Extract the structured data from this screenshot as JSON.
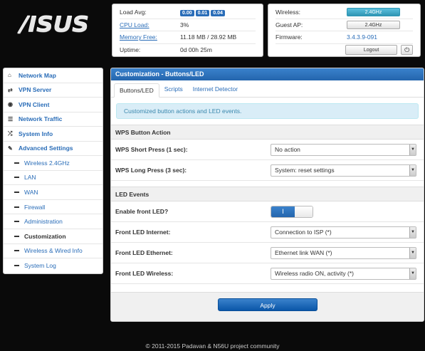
{
  "logo": {
    "text": "/ISUS"
  },
  "status_left": [
    {
      "label": "Load Avg:",
      "label_link": false,
      "badges": [
        "0.00",
        "0.01",
        "0.04"
      ]
    },
    {
      "label": "CPU Load:",
      "label_link": true,
      "value": "3%"
    },
    {
      "label": "Memory Free:",
      "label_link": true,
      "value": "11.18 MB / 28.92 MB"
    },
    {
      "label": "Uptime:",
      "label_link": false,
      "value": "0d 00h 25m"
    }
  ],
  "status_right": {
    "wireless": {
      "label": "Wireless:",
      "button": "2.4GHz"
    },
    "guest_ap": {
      "label": "Guest AP:",
      "button": "2.4GHz"
    },
    "firmware": {
      "label": "Firmware:",
      "value": "3.4.3.9-091"
    },
    "logout": "Logout",
    "power_icon": "power-icon"
  },
  "sidebar": {
    "items": [
      {
        "label": "Network Map",
        "icon": "home-icon"
      },
      {
        "label": "VPN Server",
        "icon": "swap-icon"
      },
      {
        "label": "VPN Client",
        "icon": "globe-icon"
      },
      {
        "label": "Network Traffic",
        "icon": "list-icon"
      },
      {
        "label": "System Info",
        "icon": "shuffle-icon"
      },
      {
        "label": "Advanced Settings",
        "icon": "wrench-icon"
      }
    ],
    "subitems": [
      {
        "label": "Wireless 2.4GHz"
      },
      {
        "label": "LAN"
      },
      {
        "label": "WAN"
      },
      {
        "label": "Firewall"
      },
      {
        "label": "Administration"
      },
      {
        "label": "Customization"
      },
      {
        "label": "Wireless & Wired Info"
      },
      {
        "label": "System Log"
      }
    ]
  },
  "main": {
    "header": "Customization - Buttons/LED",
    "tabs": [
      "Buttons/LED",
      "Scripts",
      "Internet Detector"
    ],
    "info": "Customized button actions and LED events.",
    "section_wps": "WPS Button Action",
    "wps_short": {
      "label": "WPS Short Press (1 sec):",
      "value": "No action"
    },
    "wps_long": {
      "label": "WPS Long Press (3 sec):",
      "value": "System: reset settings"
    },
    "section_led": "LED Events",
    "enable_led": {
      "label": "Enable front LED?",
      "toggle": "I"
    },
    "led_internet": {
      "label": "Front LED Internet:",
      "value": "Connection to ISP (*)"
    },
    "led_ethernet": {
      "label": "Front LED Ethernet:",
      "value": "Ethernet link WAN (*)"
    },
    "led_wireless": {
      "label": "Front LED Wireless:",
      "value": "Wireless radio ON, activity (*)"
    },
    "apply": "Apply"
  },
  "footer": "© 2011-2015 Padavan & N56U project community",
  "colors": {
    "accent": "#2a6db8",
    "info_bg": "#d9edf7"
  }
}
